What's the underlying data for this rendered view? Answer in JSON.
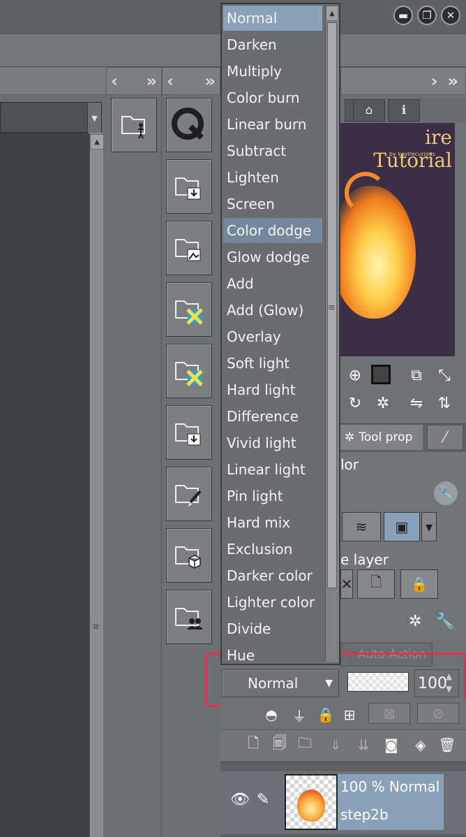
{
  "window": {
    "controls": [
      {
        "name": "minimize",
        "glyph": "▬"
      },
      {
        "name": "maximize",
        "glyph": "❐"
      },
      {
        "name": "close",
        "glyph": "✕"
      }
    ]
  },
  "column_headers": {
    "left_nav": "‹ »",
    "right_nav": "› »"
  },
  "blend_modes": {
    "options": [
      "Normal",
      "Darken",
      "Multiply",
      "Color burn",
      "Linear burn",
      "Subtract",
      "Lighten",
      "Screen",
      "Color dodge",
      "Glow dodge",
      "Add",
      "Add (Glow)",
      "Overlay",
      "Soft light",
      "Hard light",
      "Difference",
      "Vivid light",
      "Linear light",
      "Pin light",
      "Hard mix",
      "Exclusion",
      "Darker color",
      "Lighter color",
      "Divide",
      "Hue"
    ],
    "selected": "Normal",
    "hovered": "Color dodge"
  },
  "navigator": {
    "preview_title": "ire Tutorial",
    "preview_subtitle": "by kaylrecurious"
  },
  "tool_property": {
    "tab_label": "Tool prop",
    "partial_label": "lor",
    "layer_label": "e layer"
  },
  "auto_action": {
    "label": "Auto Action"
  },
  "layer_panel": {
    "blend_mode": "Normal",
    "opacity": 100,
    "opacity_text": "100",
    "layer": {
      "summary": "100 % Normal",
      "name": "step2b"
    }
  },
  "colors": {
    "selection": "#8aa2b9",
    "highlight_box": "#e0305a",
    "panel": "#6e7074"
  }
}
